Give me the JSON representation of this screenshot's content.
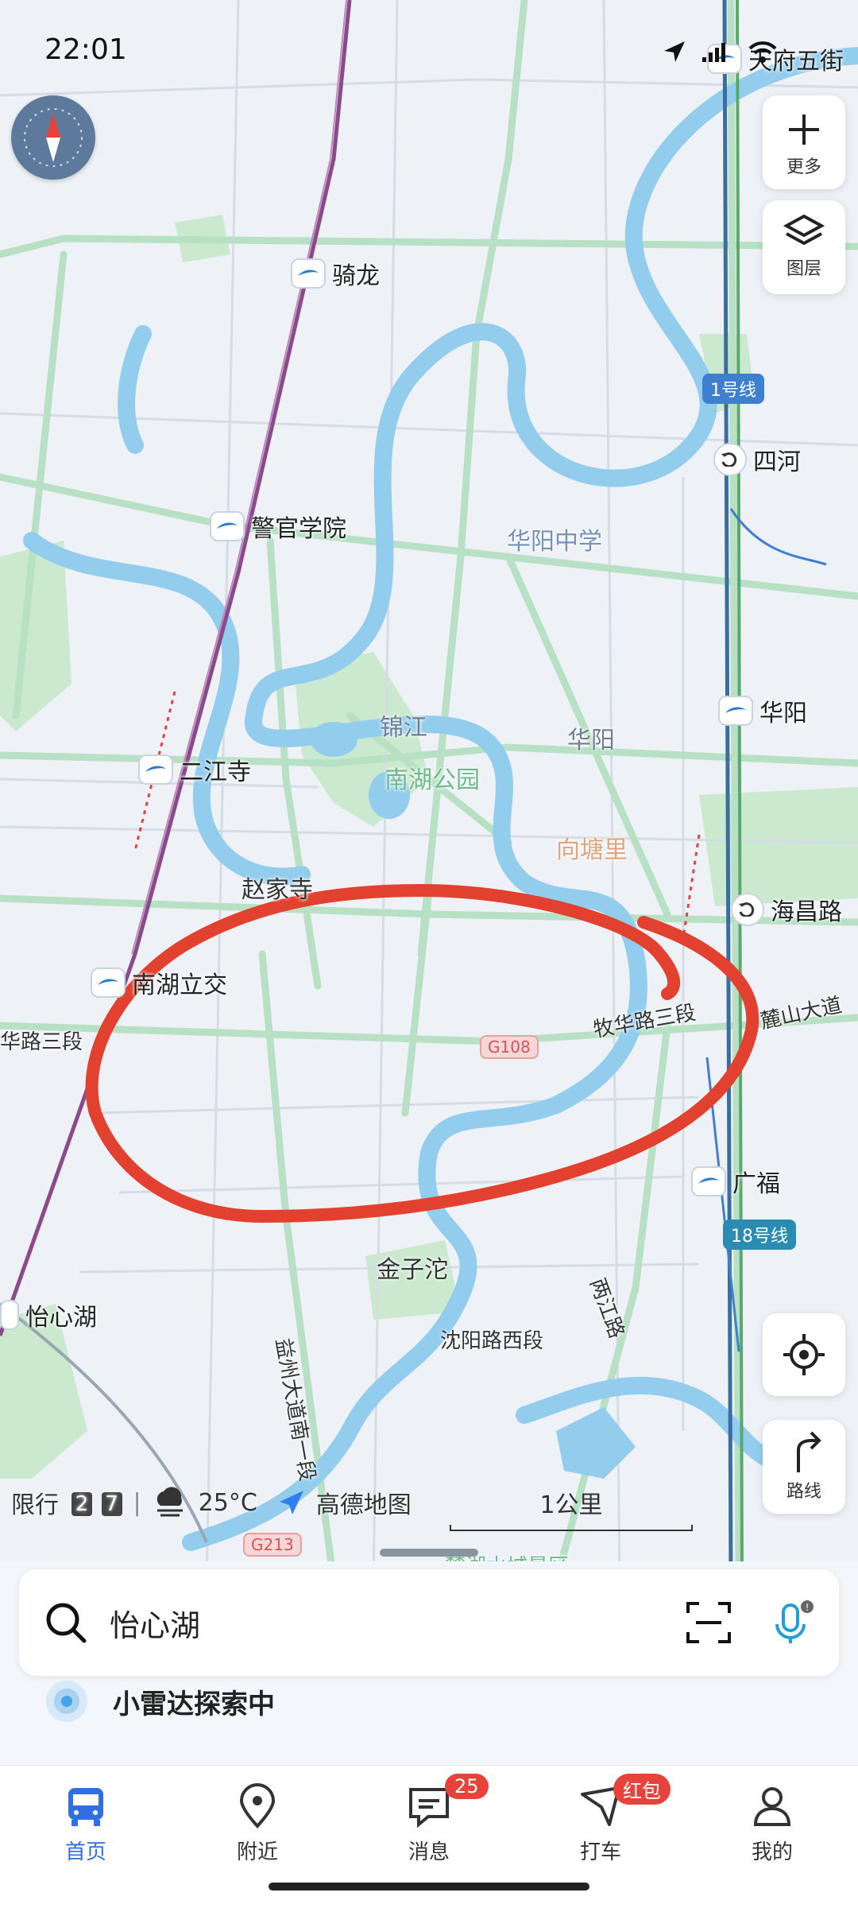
{
  "status_bar": {
    "time": "22:01"
  },
  "map": {
    "place_labels": [
      "骑龙",
      "警官学院",
      "二江寺",
      "南湖立交",
      "怡心湖",
      "四河",
      "华阳",
      "海昌路",
      "广福",
      "天府五街"
    ],
    "area_labels": {
      "huayang_school": "华阳中学",
      "jinjiang": "锦江",
      "huayang": "华阳",
      "nanhu_park": "南湖公园",
      "xiangtangli": "向塘里",
      "zhaojiasi": "赵家寺",
      "jinzituo": "金子沱",
      "shenyang_road": "沈阳路西段",
      "muhua_road": "牧华路三段",
      "muhua_road_left": "华路三段",
      "lushan_ave": "麓山大道",
      "liangjiang_road": "两江路",
      "yizhou_ave": "益州大道南一段",
      "lake_area": "麓湖水城景区",
      "more_label": "更多",
      "layers_label": "图层"
    },
    "badges": {
      "line1": "1号线",
      "line18": "18号线",
      "g108": "G108",
      "g213": "G213"
    }
  },
  "controls": {
    "more": "更多",
    "layers": "图层",
    "route": "路线"
  },
  "bottom_info": {
    "restriction_label": "限行",
    "restriction_digits": [
      "2",
      "7"
    ],
    "temperature": "25°C",
    "brand": "高德地图",
    "scale": "1公里"
  },
  "search": {
    "value": "怡心湖"
  },
  "radar": {
    "label": "小雷达探索中"
  },
  "tabs": [
    {
      "label": "首页",
      "icon": "bus-icon",
      "active": true
    },
    {
      "label": "附近",
      "icon": "location-pin-icon"
    },
    {
      "label": "消息",
      "icon": "message-icon",
      "badge": "25"
    },
    {
      "label": "打车",
      "icon": "taxi-icon",
      "badge": "红包"
    },
    {
      "label": "我的",
      "icon": "person-icon"
    }
  ],
  "colors": {
    "accent": "#2f6fe0",
    "badge_red": "#e8433b",
    "annotation": "#e2412f",
    "river": "#8cc8ee",
    "park": "#bfe6c2"
  }
}
